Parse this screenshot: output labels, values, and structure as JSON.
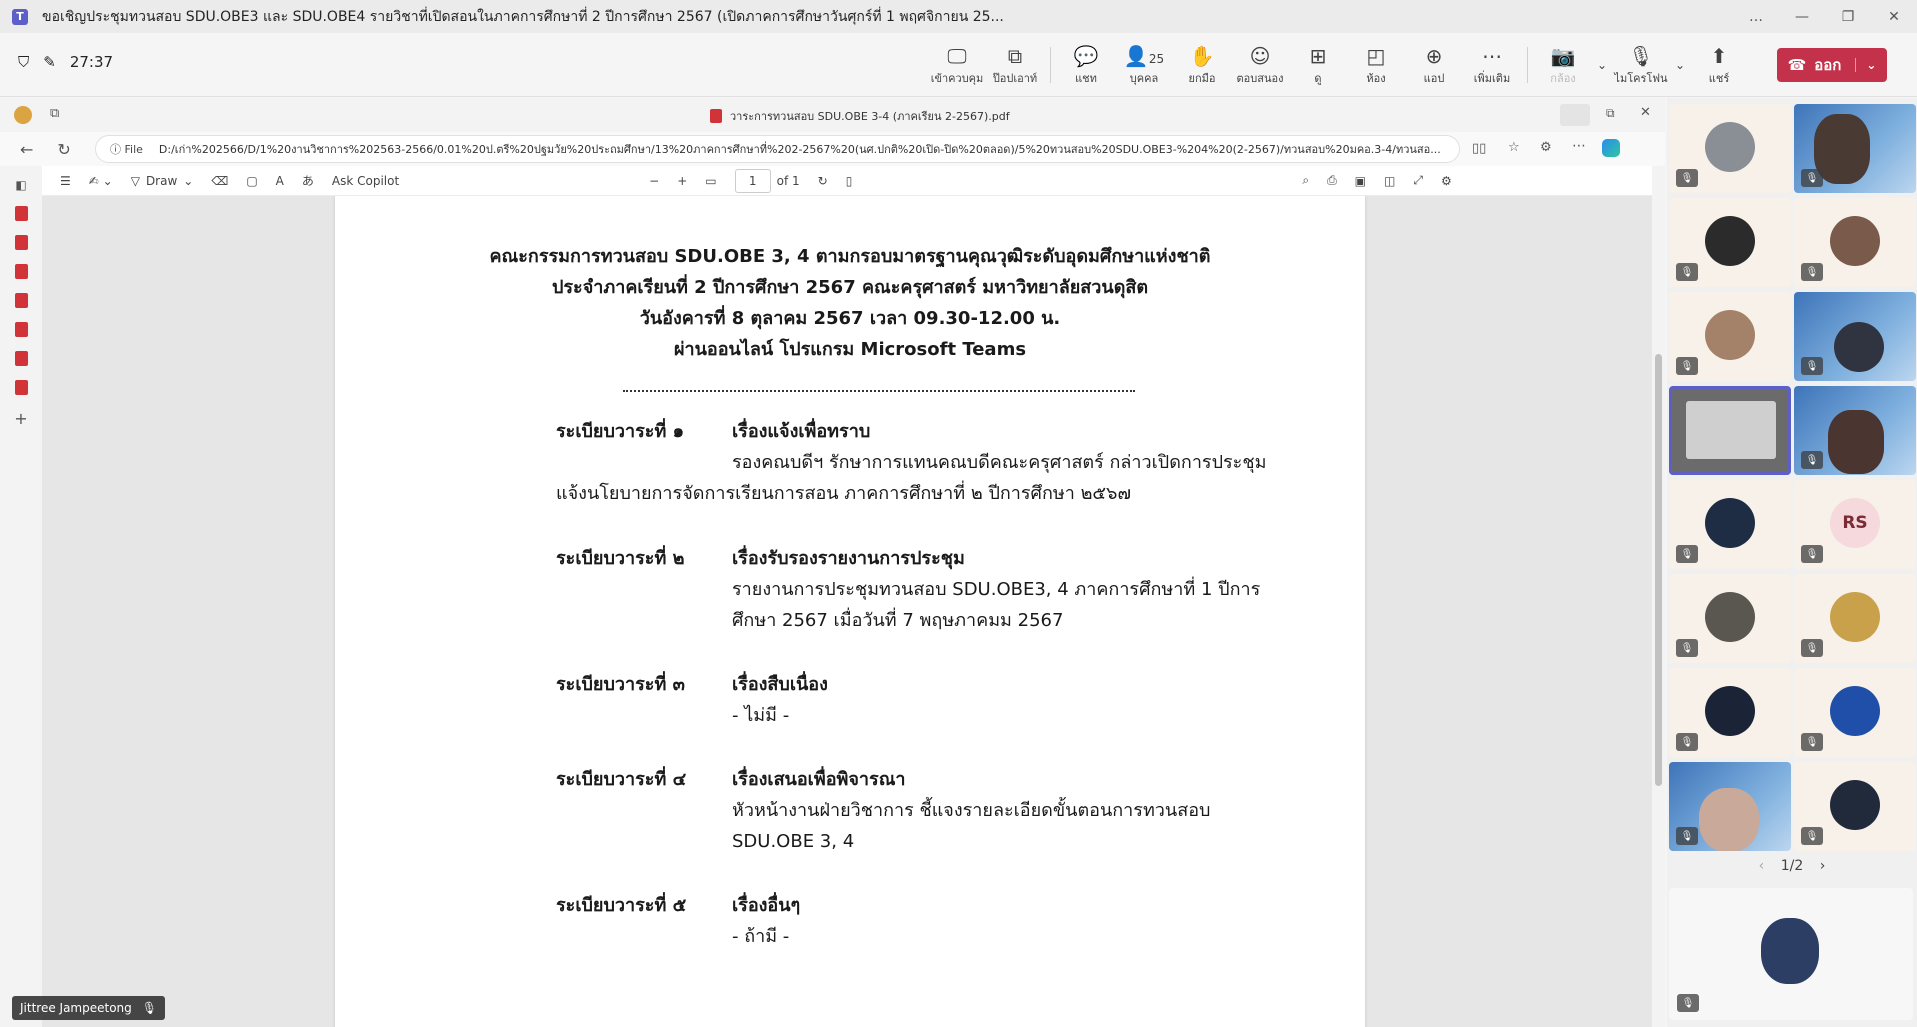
{
  "window": {
    "title": "ขอเชิญประชุมทวนสอบ SDU.OBE3 และ SDU.OBE4 รายวิชาที่เปิดสอนในภาคการศึกษาที่ 2 ปีการศึกษา 2567 (เปิดภาคการศึกษาวันศุกร์ที่ 1 พฤศจิกายน 25...",
    "controls": [
      "…",
      "—",
      "❐",
      "✕"
    ]
  },
  "meeting": {
    "timer": "27:37",
    "toolbar": [
      {
        "label": "เข้าควบคุม",
        "icon": "🖵"
      },
      {
        "label": "ป๊อปเอาท์",
        "icon": "⧉"
      },
      {
        "label": "แชท",
        "icon": "💬"
      },
      {
        "label": "บุคคล",
        "icon": "👤",
        "count": "25"
      },
      {
        "label": "ยกมือ",
        "icon": "✋"
      },
      {
        "label": "ตอบสนอง",
        "icon": "☺"
      },
      {
        "label": "ดู",
        "icon": "⊞"
      },
      {
        "label": "ห้อง",
        "icon": "◰"
      },
      {
        "label": "แอป",
        "icon": "⊕"
      },
      {
        "label": "เพิ่มเติม",
        "icon": "⋯"
      }
    ],
    "camera": {
      "label": "กล้อง",
      "icon": "📷"
    },
    "mic": {
      "label": "ไมโครโฟน",
      "icon": "🎙"
    },
    "share": {
      "label": "แชร์",
      "icon": "⬆"
    },
    "leave_label": "ออก"
  },
  "browser": {
    "tab_title": "วาระการทวนสอบ SDU.OBE 3-4 (ภาคเรียน 2-2567).pdf",
    "file_label": "File",
    "address": "D:/เก่า%202566/D/1%20งานวิชาการ%202563-2566/0.01%20ป.ตรี%20ปฐมวัย%20ประถมศึกษา/13%20ภาคการศึกษาที่%202-2567%20(นศ.ปกติ%20เปิด-ปิด%20ตลอด)/5%20ทวนสอบ%20SDU.OBE3-%204%20(2-2567)/ทวนสอบ%20มคอ.3-4/ทวนสอ..."
  },
  "pdf_toolbar": {
    "draw_label": "Draw",
    "copilot_label": "Ask Copilot",
    "page_number": "1",
    "page_total": "of 1"
  },
  "document": {
    "heading": [
      "คณะกรรมการทวนสอบ SDU.OBE 3, 4 ตามกรอบมาตรฐานคุณวุฒิระดับอุดมศึกษาแห่งชาติ",
      "ประจำภาคเรียนที่ 2 ปีการศึกษา 2567  คณะครุศาสตร์ มหาวิทยาลัยสวนดุสิต",
      "วันอังคารที่ 8 ตุลาคม 2567 เวลา 09.30-12.00 น.",
      "ผ่านออนไลน์ โปรแกรม Microsoft Teams"
    ],
    "agenda": [
      {
        "label": "ระเบียบวาระที่ ๑",
        "topic": "เรื่องแจ้งเพื่อทราบ",
        "body": "รองคณบดีฯ รักษาการแทนคณบดีคณะครุศาสตร์ กล่าวเปิดการประชุม แจ้งนโยบายการจัดการเรียนการสอน ภาคการศึกษาที่ ๒ ปีการศึกษา ๒๕๖๗"
      },
      {
        "label": "ระเบียบวาระที่ ๒",
        "topic": "เรื่องรับรองรายงานการประชุม",
        "body": "รายงานการประชุมทวนสอบ SDU.OBE3, 4 ภาคการศึกษาที่ 1 ปีการศึกษา 2567 เมื่อวันที่ 7 พฤษภาคมม 2567"
      },
      {
        "label": "ระเบียบวาระที่ ๓",
        "topic": "เรื่องสืบเนื่อง",
        "body": "- ไม่มี -"
      },
      {
        "label": "ระเบียบวาระที่ ๔",
        "topic": "เรื่องเสนอเพื่อพิจารณา",
        "body": "หัวหน้างานฝ่ายวิชาการ ชี้แจงรายละเอียดขั้นตอนการทวนสอบ SDU.OBE 3, 4"
      },
      {
        "label": "ระเบียบวาระที่ ๕",
        "topic": "เรื่องอื่นๆ",
        "body": "- ถ้ามี -"
      }
    ]
  },
  "presenter": {
    "name": "Jittree Jampeetong"
  },
  "gallery": {
    "initials_participant": "RS",
    "pager": "1/2",
    "colors": {
      "accent": "#5b5fc7",
      "leave": "#c4314b"
    }
  }
}
